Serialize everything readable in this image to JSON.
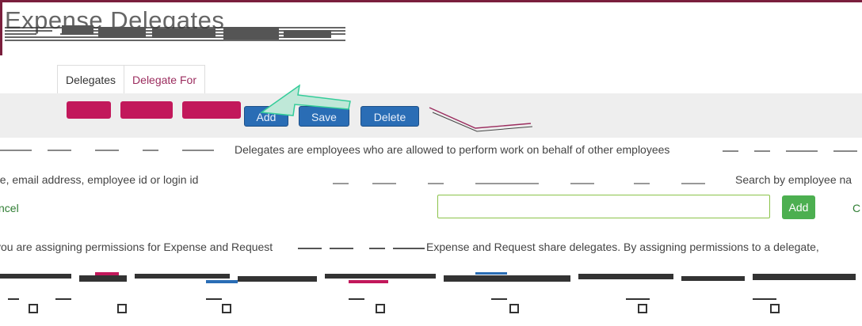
{
  "header": {
    "title": "Expense Delegates"
  },
  "tabs": [
    {
      "label": "Delegates",
      "active": true
    },
    {
      "label": "Delegate For",
      "active": false
    }
  ],
  "toolbar": {
    "add_label": "Add",
    "save_label": "Save",
    "delete_label": "Delete"
  },
  "description": "Delegates are employees who are allowed to perform work on behalf of other employees",
  "search": {
    "hint_left": "ne, email address, employee id or login id",
    "label": "Search by employee na",
    "value": "",
    "add_label": "Add",
    "cancel_left": "ncel",
    "cancel_right": "C"
  },
  "notes": {
    "left": "you are assigning permissions for Expense and Request",
    "right": "Expense and Request share delegates. By assigning permissions to a delegate,"
  },
  "colors": {
    "brand": "#7a1f3d",
    "magenta_button": "#c2185b",
    "blue_button": "#2a6db5",
    "green_button": "#4caf50",
    "tab_link": "#9b2c5e"
  },
  "table": {
    "checkbox_count": 6
  }
}
